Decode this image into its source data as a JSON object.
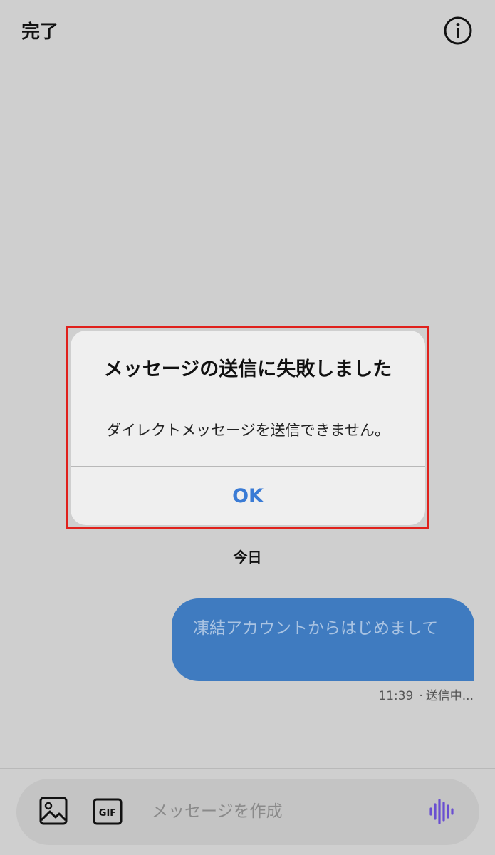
{
  "header": {
    "done_label": "完了"
  },
  "alert": {
    "title": "メッセージの送信に失敗しました",
    "message": "ダイレクトメッセージを送信できません。",
    "ok_label": "OK"
  },
  "conversation": {
    "date_label": "今日",
    "messages": [
      {
        "text": "凍結アカウントからはじめまして",
        "time": "11:39",
        "status": "送信中..."
      }
    ]
  },
  "composer": {
    "placeholder": "メッセージを作成",
    "value": ""
  },
  "colors": {
    "background": "#cfcfcf",
    "accent": "#3a7bd5",
    "bubble": "#3f7bc0",
    "highlight": "#e0211c",
    "voice": "#6a4fd1"
  },
  "icons": {
    "info": "info-icon",
    "photo": "image-icon",
    "gif": "gif-icon",
    "voice": "voice-waveform-icon"
  }
}
